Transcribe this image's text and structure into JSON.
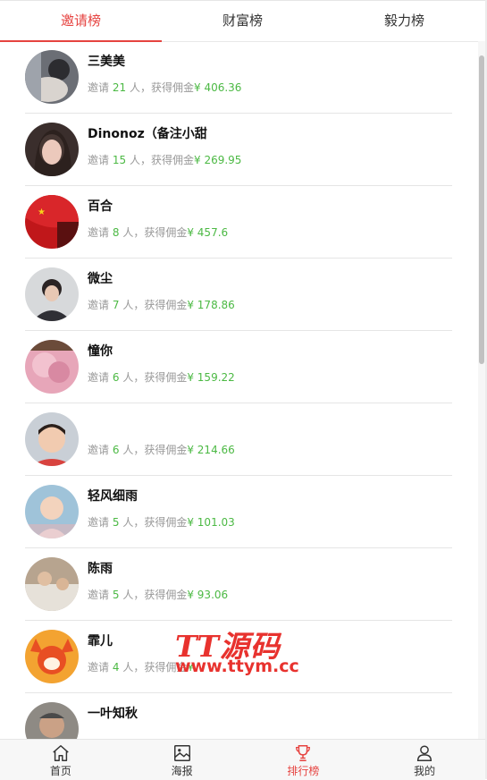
{
  "tabs": [
    {
      "label": "邀请榜"
    },
    {
      "label": "财富榜"
    },
    {
      "label": "毅力榜"
    }
  ],
  "ranking": {
    "invite_prefix": "邀请",
    "invite_suffix": "人，获得佣金",
    "currency": "¥",
    "items": [
      {
        "name": "三美美",
        "count": "21",
        "amount": "406.36"
      },
      {
        "name": "Dinonoz（备注小甜",
        "count": "15",
        "amount": "269.95"
      },
      {
        "name": "百合",
        "count": "8",
        "amount": "457.6"
      },
      {
        "name": "微尘",
        "count": "7",
        "amount": "178.86"
      },
      {
        "name": "憧你",
        "count": "6",
        "amount": "159.22"
      },
      {
        "name": "",
        "count": "6",
        "amount": "214.66"
      },
      {
        "name": "轻风细雨",
        "count": "5",
        "amount": "101.03"
      },
      {
        "name": "陈雨",
        "count": "5",
        "amount": "93.06"
      },
      {
        "name": "霏儿",
        "count": "4",
        "amount": ""
      },
      {
        "name": "一叶知秋",
        "count": "",
        "amount": ""
      }
    ]
  },
  "watermark": {
    "line1": "TT源码",
    "line2": "www.ttym.cc"
  },
  "bottom_nav": [
    {
      "label": "首页",
      "icon": "home-icon"
    },
    {
      "label": "海报",
      "icon": "poster-icon"
    },
    {
      "label": "排行榜",
      "icon": "trophy-icon"
    },
    {
      "label": "我的",
      "icon": "user-icon"
    }
  ],
  "colors": {
    "accent": "#e64340",
    "amount_green": "#4cb944"
  }
}
